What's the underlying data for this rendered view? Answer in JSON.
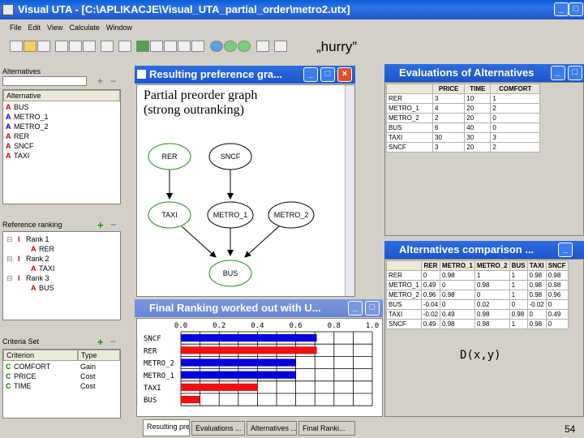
{
  "window": {
    "title": "Visual UTA - [C:\\APLIKACJE\\Visual_UTA_partial_order\\metro2.utx]",
    "buttons": [
      "_",
      "□",
      "×"
    ]
  },
  "menu": [
    "File",
    "Edit",
    "View",
    "Calculate",
    "Window"
  ],
  "annotation": "„hurry”",
  "alternatives_panel": {
    "title": "Alternatives",
    "column": "Alternative",
    "items": [
      {
        "mark": "A",
        "name": "BUS"
      },
      {
        "mark": "A",
        "name": "METRO_1"
      },
      {
        "mark": "A",
        "name": "METRO_2"
      },
      {
        "mark": "A",
        "name": "RER"
      },
      {
        "mark": "A",
        "name": "SNCF"
      },
      {
        "mark": "A",
        "name": "TAXI"
      }
    ]
  },
  "reference_panel": {
    "title": "Reference ranking",
    "ranks": [
      {
        "label": "Rank 1",
        "items": [
          "RER"
        ]
      },
      {
        "label": "Rank 2",
        "items": [
          "TAXI"
        ]
      },
      {
        "label": "Rank 3",
        "items": [
          "BUS"
        ]
      }
    ]
  },
  "criteria_panel": {
    "title": "Criteria Set",
    "columns": [
      "Criterion",
      "Type"
    ],
    "rows": [
      {
        "mark": "C",
        "name": "COMFORT",
        "type": "Gain"
      },
      {
        "mark": "C",
        "name": "PRICE",
        "type": "Cost"
      },
      {
        "mark": "C",
        "name": "TIME",
        "type": "Cost"
      }
    ]
  },
  "graph_window": {
    "title": "Resulting preference gra...",
    "heading_line1": "Partial preorder graph",
    "heading_line2": "(strong outranking)",
    "nodes": [
      "RER",
      "SNCF",
      "TAXI",
      "METRO_1",
      "METRO_2",
      "BUS"
    ]
  },
  "ranking_window": {
    "title": "Final Ranking worked out with U...",
    "axis_ticks": [
      "0.0",
      "0.2",
      "0.4",
      "0.6",
      "0.8",
      "1.0"
    ]
  },
  "evaluations_window": {
    "title": "Evaluations of Alternatives",
    "columns": [
      "",
      "PRICE",
      "TIME",
      "COMFORT"
    ],
    "rows": [
      [
        "RER",
        "3",
        "10",
        "1"
      ],
      [
        "METRO_1",
        "4",
        "20",
        "2"
      ],
      [
        "METRO_2",
        "2",
        "20",
        "0"
      ],
      [
        "BUS",
        "6",
        "40",
        "0"
      ],
      [
        "TAXI",
        "30",
        "30",
        "3"
      ],
      [
        "SNCF",
        "3",
        "20",
        "2"
      ]
    ]
  },
  "comparison_window": {
    "title": "Alternatives comparison ...",
    "formula": "D(x,y)",
    "columns": [
      "",
      "RER",
      "METRO_1",
      "METRO_2",
      "BUS",
      "TAXI",
      "SNCF"
    ],
    "rows": [
      [
        "RER",
        "0",
        "0.98",
        "1",
        "1",
        "0.98",
        "0.98"
      ],
      [
        "METRO_1",
        "0.49",
        "0",
        "0.98",
        "1",
        "0.98",
        "0.98"
      ],
      [
        "METRO_2",
        "0.96",
        "0.98",
        "0",
        "1",
        "0.98",
        "0.96"
      ],
      [
        "BUS",
        "-0.04",
        "0",
        "0.02",
        "0",
        "-0.02",
        "0"
      ],
      [
        "TAXI",
        "-0.02",
        "0.49",
        "0.98",
        "0.98",
        "0",
        "0.49"
      ],
      [
        "SNCF",
        "0.49",
        "0.98",
        "0.98",
        "1",
        "0.98",
        "0"
      ]
    ]
  },
  "tabs": [
    "Resulting pre...",
    "Evaluations ...",
    "Alternatives ...",
    "Final Ranki..."
  ],
  "page_number": "54",
  "chart_data": {
    "type": "bar",
    "orientation": "horizontal",
    "categories": [
      "SNCF",
      "RER",
      "METRO_2",
      "METRO_1",
      "TAXI",
      "BUS"
    ],
    "values": [
      0.71,
      0.71,
      0.6,
      0.6,
      0.4,
      0.1
    ],
    "colors": [
      "#0000dd",
      "#ee1111",
      "#0000dd",
      "#0000dd",
      "#ee1111",
      "#ee1111"
    ],
    "xlim": [
      0,
      1.0
    ],
    "grid": true
  }
}
